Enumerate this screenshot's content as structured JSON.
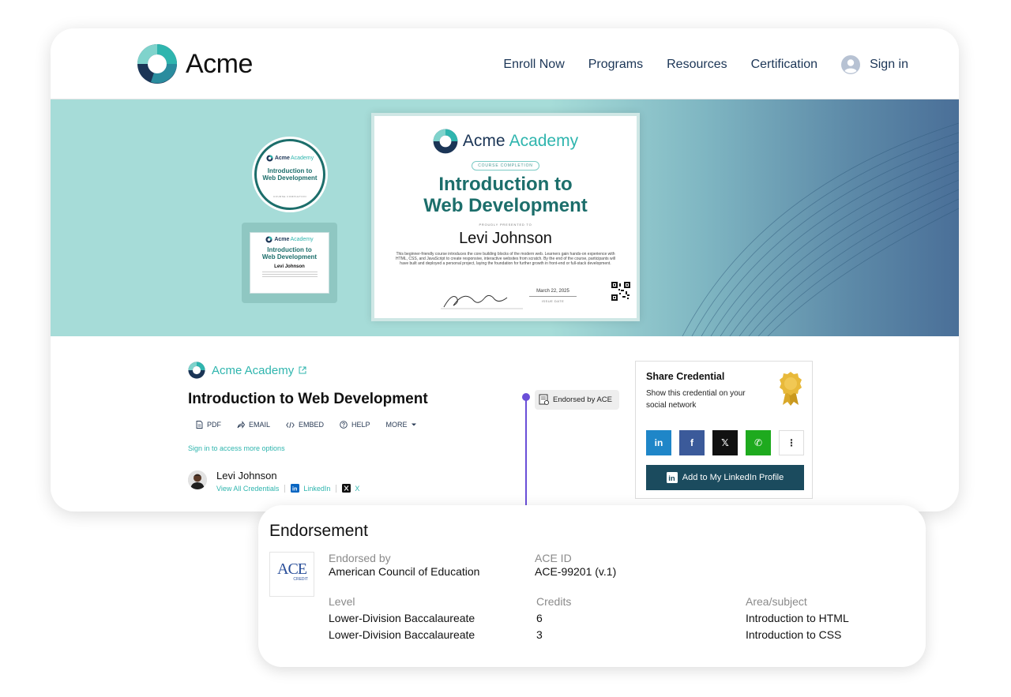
{
  "brand": {
    "name": "Acme",
    "accent": "#2fb5ae",
    "navy": "#1b3556",
    "teal_dark": "#1c6e6b"
  },
  "nav": {
    "links": [
      "Enroll Now",
      "Programs",
      "Resources",
      "Certification"
    ],
    "signin": "Sign in"
  },
  "certificate": {
    "brand_first": "Acme",
    "brand_second": "Academy",
    "pill": "COURSE COMPLETION",
    "title_line1": "Introduction to",
    "title_line2": "Web Development",
    "presented": "PROUDLY PRESENTED TO",
    "name": "Levi Johnson",
    "description": "This beginner-friendly course introduces the core building blocks of the modern web. Learners gain hands-on experience with HTML, CSS, and JavaScript to create responsive, interactive websites from scratch. By the end of the course, participants will have built and deployed a personal project, laying the foundation for further growth in front-end or full-stack development.",
    "issue_date": "March 22, 2025",
    "issue_date_label": "ISSUE DATE"
  },
  "badge": {
    "brand_first": "Acme",
    "brand_second": "Academy",
    "title_line1": "Introduction to",
    "title_line2": "Web Development",
    "sub": "COURSE COMPLETION"
  },
  "thumbnail": {
    "brand_first": "Acme",
    "brand_second": "Academy",
    "title_line1": "Introduction to",
    "title_line2": "Web Development",
    "name": "Levi Johnson"
  },
  "credential": {
    "issuer": "Acme Academy",
    "title": "Introduction to Web Development",
    "actions": [
      {
        "label": "PDF",
        "icon": "pdf-icon"
      },
      {
        "label": "EMAIL",
        "icon": "share-arrow-icon"
      },
      {
        "label": "EMBED",
        "icon": "code-icon"
      },
      {
        "label": "HELP",
        "icon": "help-icon"
      },
      {
        "label": "MORE",
        "icon": "caret-down-icon"
      }
    ],
    "signin_more": "Sign in to access more options",
    "recipient": {
      "name": "Levi Johnson",
      "view_all": "View All Credentials",
      "linkedin": "LinkedIn",
      "x": "X"
    },
    "endorsed_tag": "Endorsed by ACE"
  },
  "share": {
    "title": "Share Credential",
    "subtitle": "Show this credential on your social network",
    "buttons": [
      {
        "name": "linkedin",
        "glyph": "in",
        "color": "#1f86c8"
      },
      {
        "name": "facebook",
        "glyph": "f",
        "color": "#3b5a9a"
      },
      {
        "name": "x",
        "glyph": "𝕏",
        "color": "#111111"
      },
      {
        "name": "whatsapp",
        "glyph": "✆",
        "color": "#1eaa1e"
      },
      {
        "name": "more",
        "glyph": "⋮",
        "color": "#ffffff"
      }
    ],
    "cta": "Add to My LinkedIn Profile"
  },
  "endorsement": {
    "title": "Endorsement",
    "logo_text": "ACE",
    "logo_sub": "CREDIT",
    "endorsed_by_label": "Endorsed by",
    "endorsed_by": "American Council of Education",
    "ace_id_label": "ACE ID",
    "ace_id": "ACE-99201 (v.1)",
    "columns": {
      "level": "Level",
      "credits": "Credits",
      "area": "Area/subject"
    },
    "rows": [
      {
        "level": "Lower-Division Baccalaureate",
        "credits": "6",
        "area": "Introduction to HTML"
      },
      {
        "level": "Lower-Division Baccalaureate",
        "credits": "3",
        "area": "Introduction to CSS"
      }
    ]
  }
}
